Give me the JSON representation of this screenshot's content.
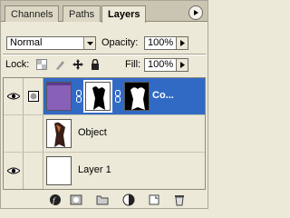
{
  "tabs": [
    {
      "label": "Channels",
      "active": false
    },
    {
      "label": "Paths",
      "active": false
    },
    {
      "label": "Layers",
      "active": true
    }
  ],
  "blend_mode": {
    "value": "Normal"
  },
  "opacity": {
    "label": "Opacity:",
    "value": "100%"
  },
  "lock": {
    "label": "Lock:"
  },
  "fill": {
    "label": "Fill:",
    "value": "100%"
  },
  "layers": [
    {
      "name": "Co...",
      "visible": true,
      "selected": true
    },
    {
      "name": "Object",
      "visible": false,
      "selected": false
    },
    {
      "name": "Layer 1",
      "visible": true,
      "selected": false
    }
  ],
  "colors": {
    "selection": "#316ac5",
    "panel_bg": "#ece9d8",
    "purple_fill": "#8860b8"
  },
  "icons": {
    "footer": [
      "layer-style-icon",
      "layer-mask-icon",
      "new-group-icon",
      "adjustment-layer-icon",
      "new-layer-icon",
      "trash-icon"
    ]
  }
}
